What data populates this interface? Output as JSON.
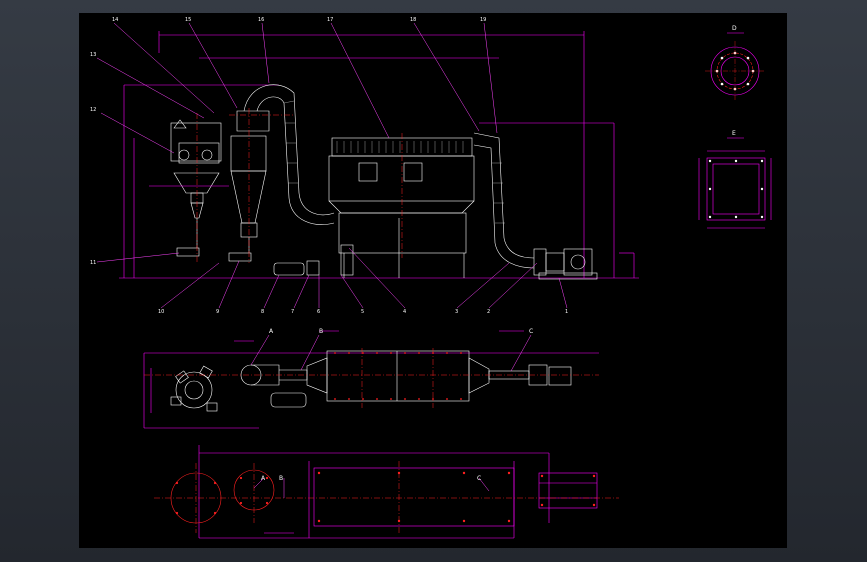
{
  "callouts": {
    "n14": "14",
    "n15": "15",
    "n16": "16",
    "n17": "17",
    "n18": "18",
    "n19": "19",
    "n13": "13",
    "n12": "12",
    "n11": "11",
    "n10": "10",
    "n9": "9",
    "n8": "8",
    "n7": "7",
    "n6": "6",
    "n5": "5",
    "n4": "4",
    "n3": "3",
    "n2": "2",
    "n1": "1"
  },
  "views": {
    "D": "D",
    "E": "E",
    "A": "A",
    "B": "B",
    "C": "C"
  },
  "colors": {
    "line": "#ff00ff",
    "center": "#ff2020",
    "equipment": "#ffffff",
    "leader": "#ff44ff",
    "sheet": "#000000",
    "window": "#2a2f37"
  }
}
